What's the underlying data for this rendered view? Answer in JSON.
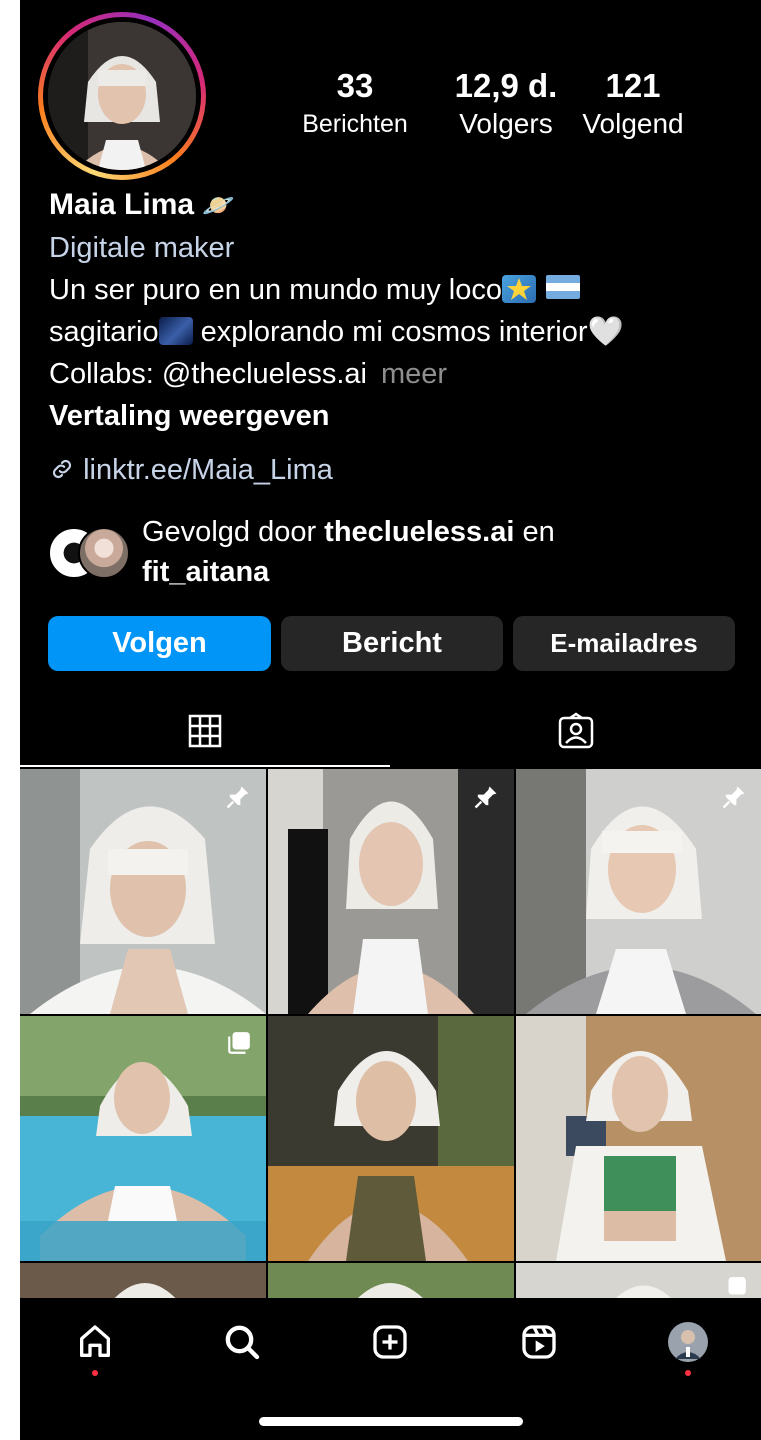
{
  "profile": {
    "stats": [
      {
        "value": "33",
        "label": "Berichten"
      },
      {
        "value": "12,9 d.",
        "label": "Volgers"
      },
      {
        "value": "121",
        "label": "Volgend"
      }
    ],
    "name": "Maia Lima",
    "name_emoji": "🪐",
    "category": "Digitale maker",
    "bio_line1": "Un ser puro en un mundo muy loco",
    "bio_line2_a": "sagitario",
    "bio_line2_b": " explorando mi cosmos interior",
    "bio_heart": "🤍",
    "bio_line3": "Collabs: @theclueless.ai",
    "more": "meer",
    "translate": "Vertaling weergeven",
    "link": "linktr.ee/Maia_Lima"
  },
  "followed_by": {
    "prefix": "Gevolgd door ",
    "user1": "theclueless.ai",
    "conj": " en",
    "user2": "fit_aitana"
  },
  "buttons": {
    "follow": "Volgen",
    "message": "Bericht",
    "email": "E-mailadres"
  },
  "tabs": [
    "grid-icon",
    "tagged-icon"
  ],
  "grid_posts": [
    {
      "pinned": true,
      "multi": false
    },
    {
      "pinned": true,
      "multi": false
    },
    {
      "pinned": true,
      "multi": false
    },
    {
      "pinned": false,
      "multi": true
    },
    {
      "pinned": false,
      "multi": false
    },
    {
      "pinned": false,
      "multi": false
    }
  ],
  "bottom_nav": [
    "home-icon",
    "search-icon",
    "create-icon",
    "reels-icon",
    "profile-avatar"
  ],
  "colors": {
    "accent": "#0095f6",
    "secondary_button": "#262626",
    "link": "#c7d4e8",
    "notification_dot": "#ff3040"
  }
}
